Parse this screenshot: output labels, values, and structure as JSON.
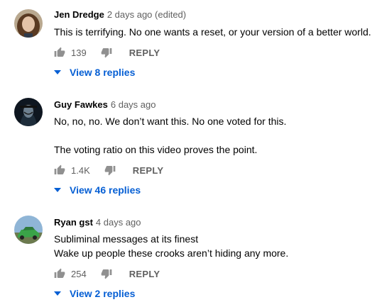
{
  "comments": [
    {
      "author": "Jen Dredge",
      "time": "2 days ago (edited)",
      "lines": [
        "This is terrifying. No one wants a reset, or your version of a better world."
      ],
      "likes": "139",
      "reply_label": "REPLY",
      "view_replies": "View 8 replies"
    },
    {
      "author": "Guy Fawkes",
      "time": "6 days ago",
      "lines": [
        "No, no, no. We don’t want this. No one voted for this.",
        "The voting ratio on this video proves the point."
      ],
      "likes": "1.4K",
      "reply_label": "REPLY",
      "view_replies": "View 46 replies"
    },
    {
      "author": "Ryan gst",
      "time": "4 days ago",
      "lines": [
        "Subliminal messages at its finest",
        "Wake up people these crooks aren’t hiding any more."
      ],
      "likes": "254",
      "reply_label": "REPLY",
      "view_replies": "View 2 replies"
    }
  ],
  "icons": {
    "like": "thumb-up-icon",
    "dislike": "thumb-down-icon",
    "expand": "caret-down-icon"
  },
  "colors": {
    "link": "#065fd4",
    "secondary": "#606060",
    "primary": "#030303"
  }
}
